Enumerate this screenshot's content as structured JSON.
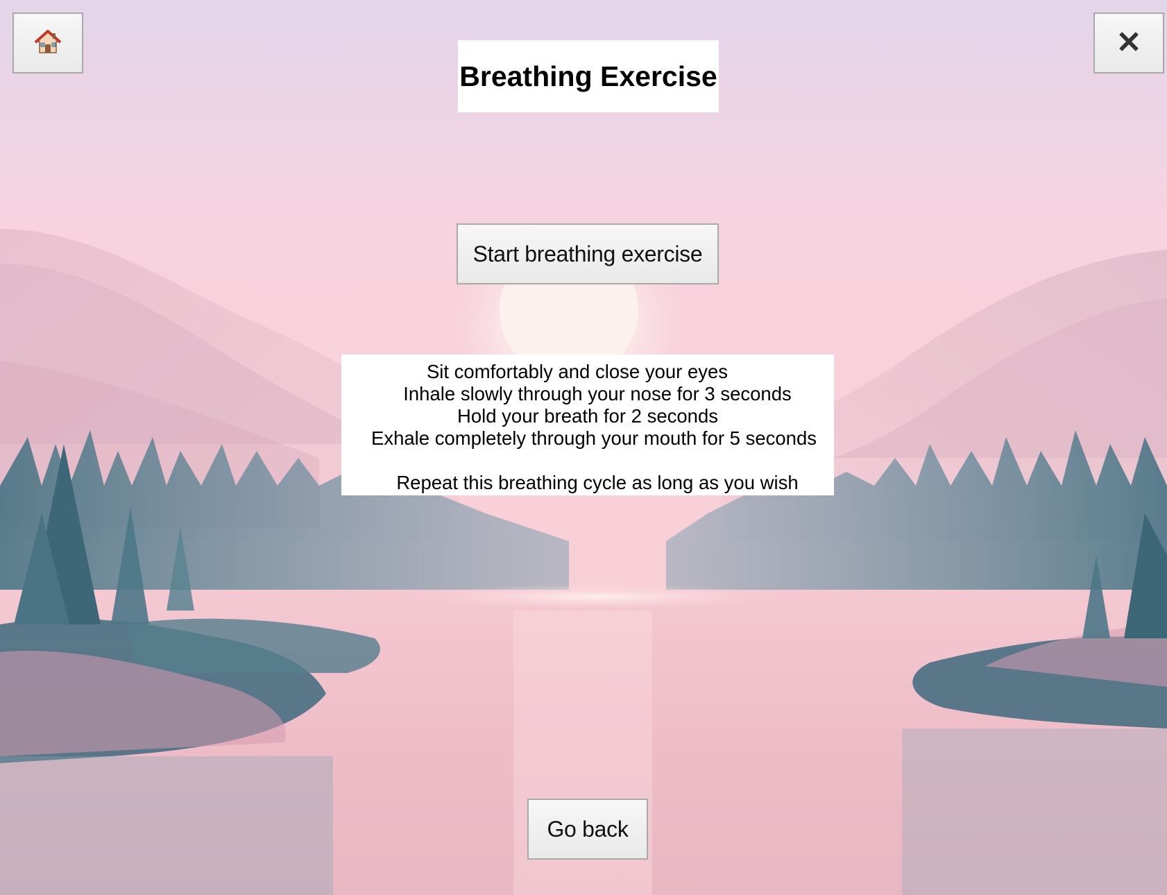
{
  "header": {
    "title": "Breathing Exercise",
    "home_icon": "house-icon",
    "close_icon": "close-icon",
    "close_glyph": "✕"
  },
  "main": {
    "start_label": "Start breathing exercise",
    "instructions": [
      "Sit comfortably and close your eyes",
      "Inhale slowly through your nose for 3 seconds",
      "Hold your breath for 2 seconds",
      "Exhale completely through your mouth for 5 seconds",
      "Repeat this breathing cycle as long as you wish"
    ]
  },
  "footer": {
    "back_label": "Go back"
  },
  "colors": {
    "sky_top": "#e4d5ea",
    "sky_mid": "#f8cdd8",
    "water": "#f0b9c4",
    "trees": "#4f7c8c",
    "button_border": "#a9a9a9"
  }
}
